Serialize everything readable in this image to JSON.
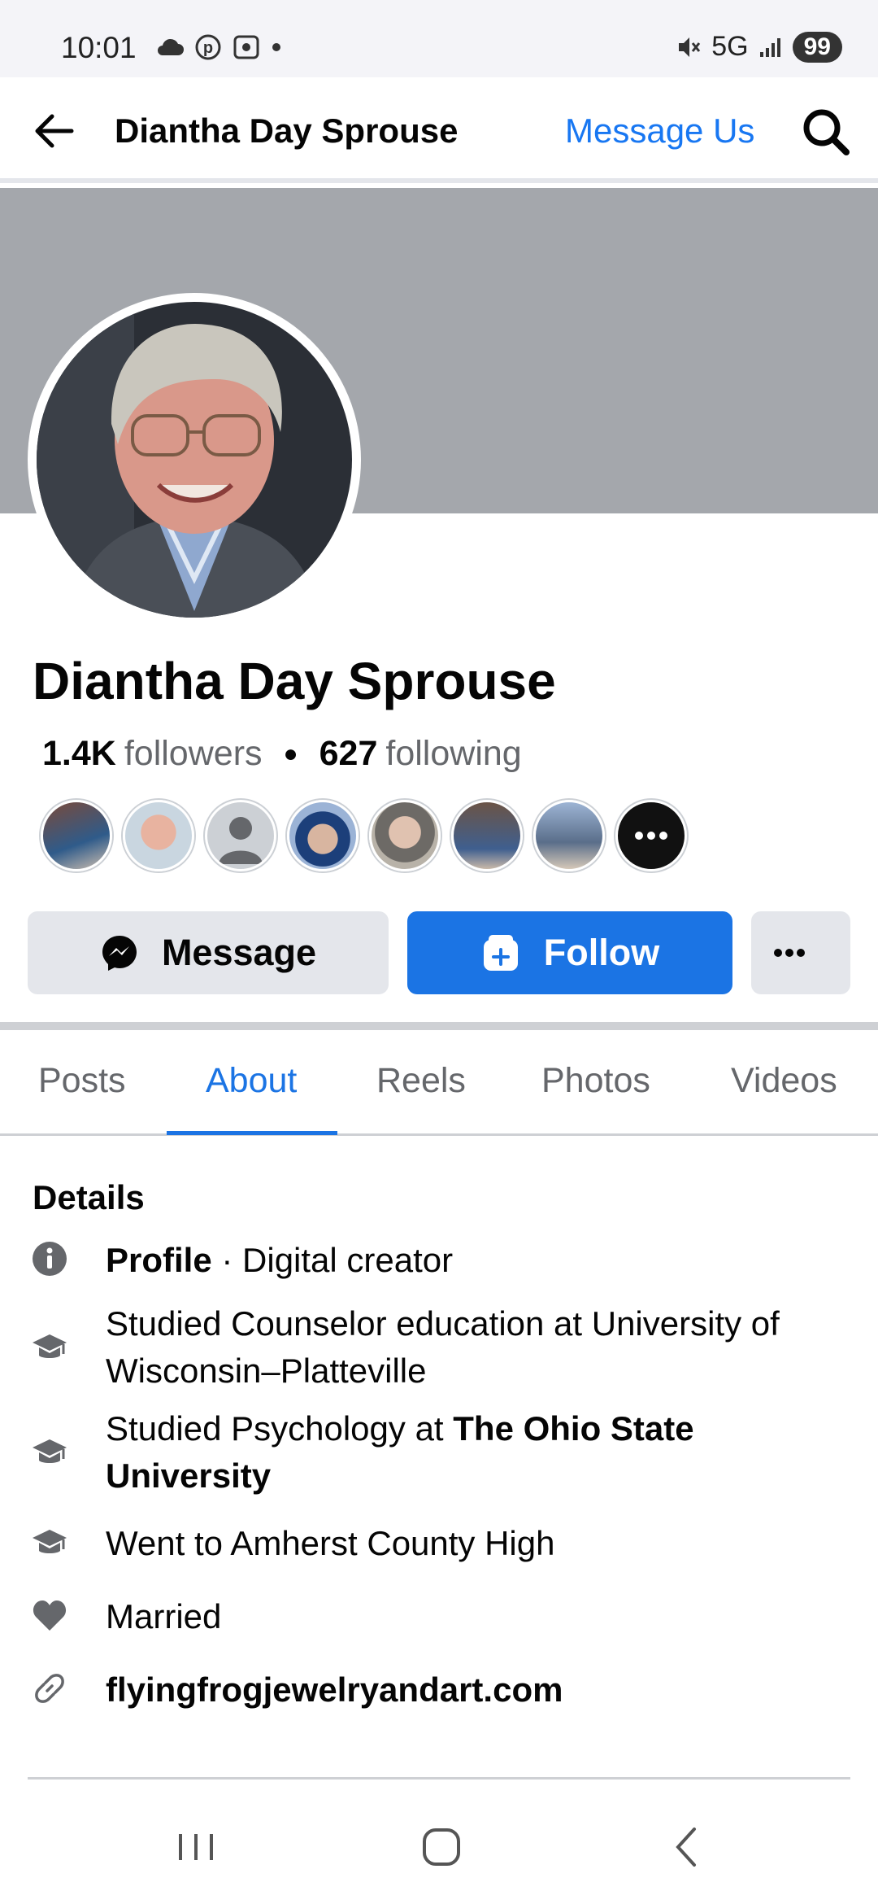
{
  "status_bar": {
    "time": "10:01",
    "network": "5G",
    "battery": "99"
  },
  "header": {
    "title": "Diantha Day Sprouse",
    "message_us": "Message Us"
  },
  "profile": {
    "name": "Diantha Day Sprouse",
    "followers_count": "1.4K",
    "followers_label": "followers",
    "following_count": "627",
    "following_label": "following"
  },
  "actions": {
    "message": "Message",
    "follow": "Follow"
  },
  "tabs": [
    {
      "label": "Posts"
    },
    {
      "label": "About"
    },
    {
      "label": "Reels"
    },
    {
      "label": "Photos"
    },
    {
      "label": "Videos"
    }
  ],
  "active_tab": "About",
  "details": {
    "title": "Details",
    "profile_label": "Profile",
    "profile_type": " · Digital creator",
    "edu1": "Studied Counselor education at University of Wisconsin–Platteville",
    "edu2_prefix": "Studied Psychology at ",
    "edu2_school": "The Ohio State University",
    "edu3": "Went to Amherst County High",
    "relationship": "Married",
    "website": "flyingfrogjewelryandart.com"
  },
  "icons": {
    "back": "arrow-left-icon",
    "search": "search-icon",
    "info": "info-icon",
    "education": "graduation-cap-icon",
    "relationship": "heart-icon",
    "link": "link-icon"
  },
  "colors": {
    "accent": "#1b74e4",
    "cover": "#a4a7ac",
    "button_gray": "#e4e6eb"
  }
}
